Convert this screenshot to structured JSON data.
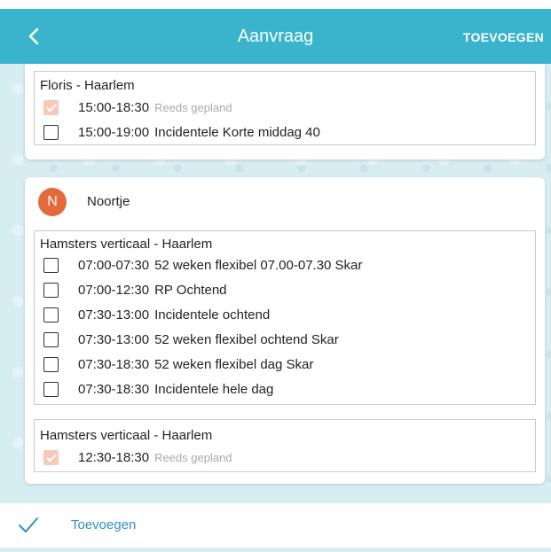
{
  "header": {
    "title": "Aanvraag",
    "action_label": "TOEVOEGEN",
    "back_icon": "chevron-left-icon",
    "color": "#3ab3cd"
  },
  "card1": {
    "group": {
      "title": "Floris - Haarlem",
      "rows": [
        {
          "time": "15:00-18:30",
          "label": "Reeds gepland",
          "checked": true
        },
        {
          "time": "15:00-19:00",
          "label": "Incidentele Korte middag 40",
          "checked": false
        }
      ]
    }
  },
  "card2": {
    "avatar_letter": "N",
    "avatar_color": "#e36a3b",
    "child_name": "Noortje",
    "group1": {
      "title": "Hamsters verticaal - Haarlem",
      "rows": [
        {
          "time": "07:00-07:30",
          "label": "52 weken flexibel 07.00-07.30 Skar",
          "checked": false
        },
        {
          "time": "07:00-12:30",
          "label": "RP Ochtend",
          "checked": false
        },
        {
          "time": "07:30-13:00",
          "label": "Incidentele ochtend",
          "checked": false
        },
        {
          "time": "07:30-13:00",
          "label": "52 weken flexibel ochtend Skar",
          "checked": false
        },
        {
          "time": "07:30-18:30",
          "label": "52 weken flexibel dag Skar",
          "checked": false
        },
        {
          "time": "07:30-18:30",
          "label": "Incidentele hele dag",
          "checked": false
        }
      ]
    },
    "group2": {
      "title": "Hamsters verticaal - Haarlem",
      "rows": [
        {
          "time": "12:30-18:30",
          "label": "Reeds gepland",
          "checked": true
        }
      ]
    }
  },
  "footer": {
    "label": "Toevoegen",
    "icon": "checkmark-icon"
  }
}
